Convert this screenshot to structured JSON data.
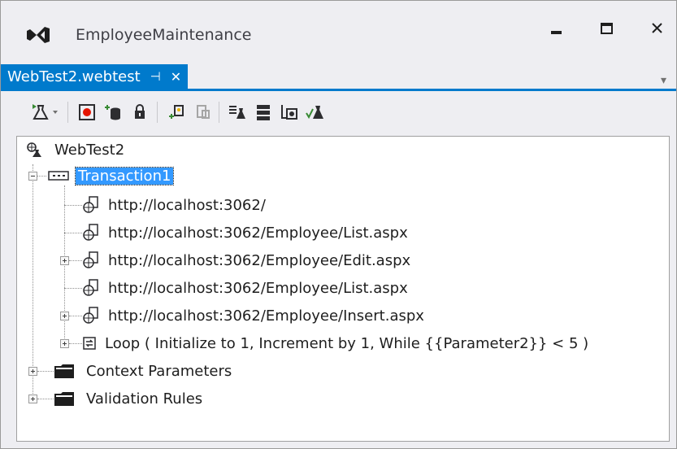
{
  "window": {
    "title": "EmployeeMaintenance",
    "icons": {
      "logo": "visual-studio-logo",
      "minimize": "minimize-icon",
      "maximize": "maximize-icon",
      "close": "close-icon"
    }
  },
  "tab": {
    "label": "WebTest2.webtest",
    "pin_glyph": "⊣",
    "close_glyph": "✕",
    "dropdown_glyph": "▾"
  },
  "toolbar": {
    "buttons": [
      "run-test-icon",
      "run-dropdown-icon",
      "record-icon",
      "add-datasource-icon",
      "credentials-icon",
      "add-request-plugin-icon",
      "add-web-test-plugin-icon",
      "parameterize-icon",
      "performance-session-icon",
      "generate-code-icon",
      "set-validation-level-icon"
    ]
  },
  "tree": {
    "root": {
      "label": "WebTest2",
      "icon": "webtest-icon"
    },
    "transaction": {
      "label": "Transaction1",
      "icon": "transaction-icon",
      "expanded": true
    },
    "requests": [
      {
        "label": "http://localhost:3062/",
        "expandable": false
      },
      {
        "label": "http://localhost:3062/Employee/List.aspx",
        "expandable": false
      },
      {
        "label": "http://localhost:3062/Employee/Edit.aspx",
        "expandable": true
      },
      {
        "label": "http://localhost:3062/Employee/List.aspx",
        "expandable": false
      },
      {
        "label": "http://localhost:3062/Employee/Insert.aspx",
        "expandable": true
      }
    ],
    "loop": {
      "label": "Loop ( Initialize to 1, Increment by 1, While {{Parameter2}} < 5 )",
      "icon": "loop-icon"
    },
    "folders": [
      {
        "label": "Context Parameters",
        "icon": "folder-icon"
      },
      {
        "label": "Validation Rules",
        "icon": "folder-icon"
      }
    ]
  }
}
